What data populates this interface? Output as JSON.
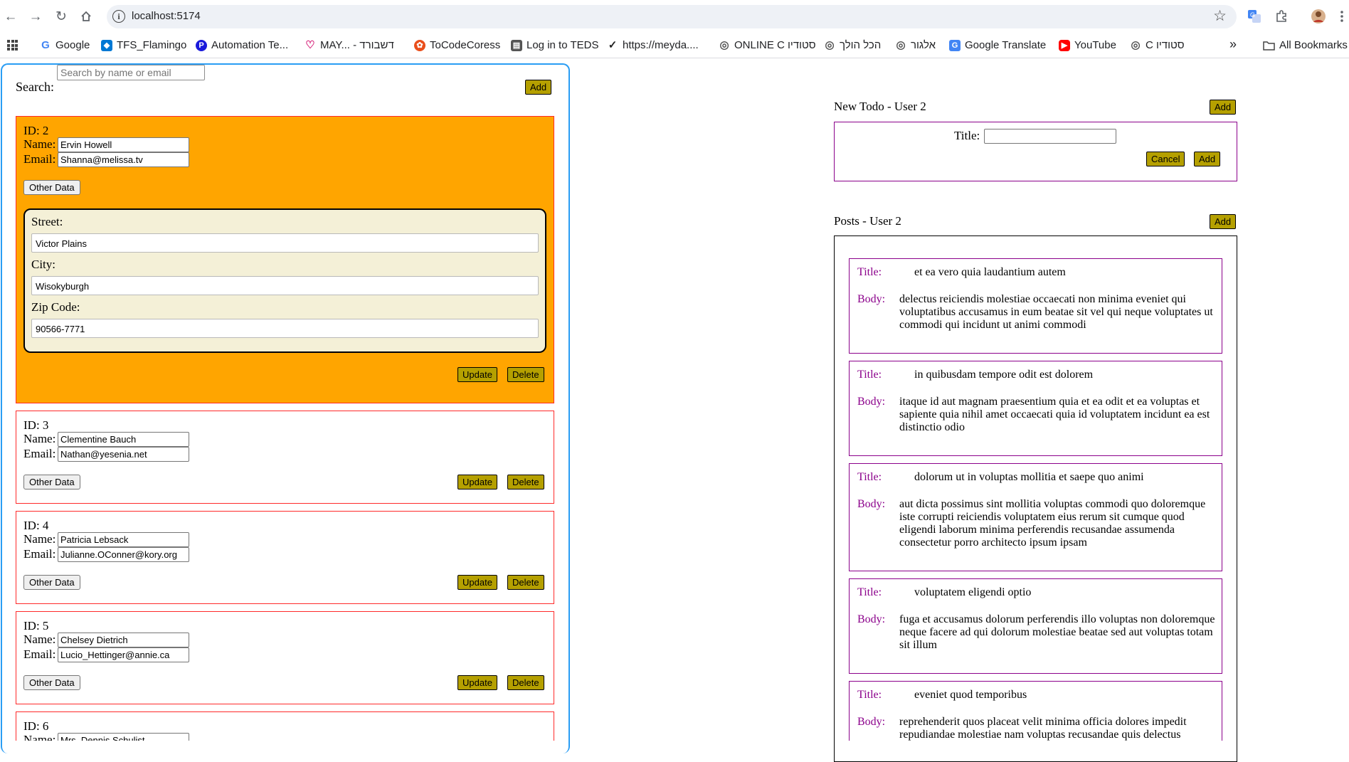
{
  "browser": {
    "url": "localhost:5174",
    "bookmarks": [
      {
        "label": "Google",
        "icon": "google-icon",
        "color": "#4285f4"
      },
      {
        "label": "TFS_Flamingo",
        "icon": "devops-icon",
        "color": "#0078d4"
      },
      {
        "label": "Automation Te...",
        "icon": "p-icon",
        "color": "#1a1adb"
      },
      {
        "label": "MAY... - דשבורד",
        "icon": "heart-icon",
        "color": "#d6247b"
      },
      {
        "label": "ToCodeCoress",
        "icon": "tocode-icon",
        "color": "#e94e1b"
      },
      {
        "label": "Log in to TEDS",
        "icon": "teds-icon",
        "color": "#555555"
      },
      {
        "label": "https://meyda....",
        "icon": "meyda-icon",
        "color": "#222222"
      },
      {
        "label": "ONLINE C סטודיו",
        "icon": "globe-icon",
        "color": "#555555"
      },
      {
        "label": "הכל הולך",
        "icon": "globe-icon",
        "color": "#555555"
      },
      {
        "label": "אלגור",
        "icon": "globe-icon",
        "color": "#555555"
      },
      {
        "label": "Google Translate",
        "icon": "translate-icon",
        "color": "#4285f4"
      },
      {
        "label": "YouTube",
        "icon": "youtube-icon",
        "color": "#ff0000"
      },
      {
        "label": "C סטודיו",
        "icon": "globe-icon",
        "color": "#555555"
      }
    ],
    "all_bookmarks": "All Bookmarks",
    "more": "»"
  },
  "users_panel": {
    "search_label": "Search:",
    "search_placeholder": "Search by name or email",
    "add_label": "Add",
    "id_prefix": "ID: ",
    "name_label": "Name:",
    "email_label": "Email:",
    "other_data_label": "Other Data",
    "update_label": "Update",
    "delete_label": "Delete",
    "selected": {
      "id": "2",
      "name": "Ervin Howell",
      "email": "Shanna@melissa.tv",
      "street_label": "Street:",
      "street": "Victor Plains",
      "city_label": "City:",
      "city": "Wisokyburgh",
      "zip_label": "Zip Code:",
      "zip": "90566-7771"
    },
    "users": [
      {
        "id": "3",
        "name": "Clementine Bauch",
        "email": "Nathan@yesenia.net"
      },
      {
        "id": "4",
        "name": "Patricia Lebsack",
        "email": "Julianne.OConner@kory.org"
      },
      {
        "id": "5",
        "name": "Chelsey Dietrich",
        "email": "Lucio_Hettinger@annie.ca"
      },
      {
        "id": "6",
        "name": "Mrs. Dennis Schulist",
        "email": ""
      }
    ],
    "colors": {
      "selected_bg": "#ffa500",
      "card_border": "#ff2a2a",
      "button_bg": "#b5a000"
    }
  },
  "todo": {
    "header": "New Todo - User 2",
    "add_label": "Add",
    "title_label": "Title:",
    "title_value": "",
    "cancel_label": "Cancel",
    "submit_label": "Add"
  },
  "posts": {
    "header": "Posts - User 2",
    "add_label": "Add",
    "title_label": "Title:",
    "body_label": "Body:",
    "items": [
      {
        "title": "et ea vero quia laudantium autem",
        "body": "delectus reiciendis molestiae occaecati non minima eveniet qui voluptatibus accusamus in eum beatae sit vel qui neque voluptates ut commodi qui incidunt ut animi commodi"
      },
      {
        "title": "in quibusdam tempore odit est dolorem",
        "body": "itaque id aut magnam praesentium quia et ea odit et ea voluptas et sapiente quia nihil amet occaecati quia id voluptatem incidunt ea est distinctio odio"
      },
      {
        "title": "dolorum ut in voluptas mollitia et saepe quo animi",
        "body": "aut dicta possimus sint mollitia voluptas commodi quo doloremque iste corrupti reiciendis voluptatem eius rerum sit cumque quod eligendi laborum minima perferendis recusandae assumenda consectetur porro architecto ipsum ipsam"
      },
      {
        "title": "voluptatem eligendi optio",
        "body": "fuga et accusamus dolorum perferendis illo voluptas non doloremque neque facere ad qui dolorum molestiae beatae sed aut voluptas totam sit illum"
      },
      {
        "title": "eveniet quod temporibus",
        "body": "reprehenderit quos placeat velit minima officia dolores impedit repudiandae molestiae nam voluptas recusandae quis delectus"
      }
    ],
    "colors": {
      "label": "#8b008b",
      "card_border": "#8b008b"
    }
  }
}
